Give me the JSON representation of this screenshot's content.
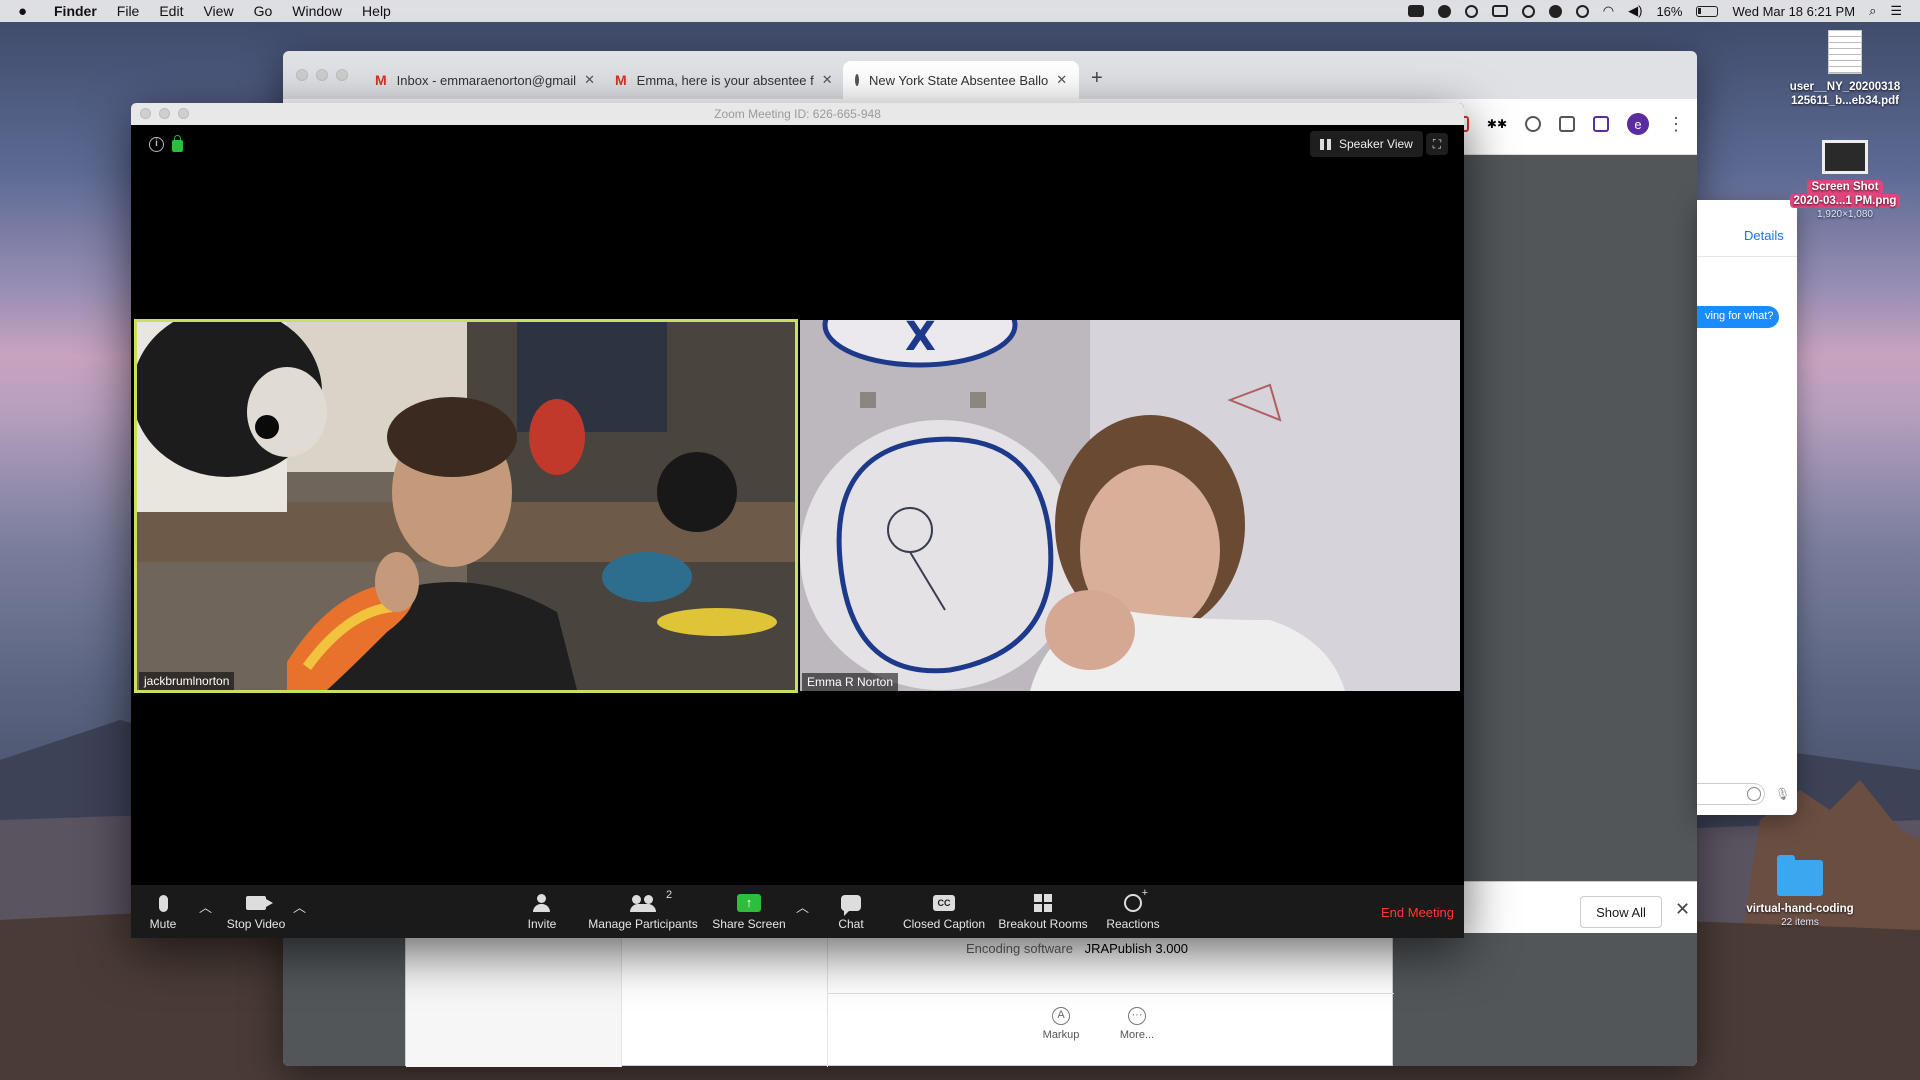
{
  "menubar": {
    "app": "Finder",
    "items": [
      "File",
      "Edit",
      "View",
      "Go",
      "Window",
      "Help"
    ],
    "battery": "16%",
    "datetime": "Wed Mar 18  6:21 PM"
  },
  "chrome": {
    "tabs": [
      {
        "label": "Inbox - emmaraenorton@gmail",
        "icon": "gmail-icon"
      },
      {
        "label": "Emma, here is your absentee f",
        "icon": "gmail-icon"
      },
      {
        "label": "New York State Absentee Ballo",
        "icon": "globe-icon"
      }
    ],
    "new_tab": "+",
    "profile_initial": "e",
    "downloads_show_all": "Show All",
    "downloads_close": "✕"
  },
  "preview": {
    "encoding_key": "Encoding software",
    "encoding_value": "JRAPublish 3.000",
    "markup_label": "Markup",
    "more_label": "More..."
  },
  "messages": {
    "details": "Details",
    "bubble": "ving for what?"
  },
  "zoom": {
    "title": "Zoom Meeting ID: 626-665-948",
    "speaker_view": "Speaker View",
    "participants": [
      {
        "name": "jackbrumlnorton"
      },
      {
        "name": "Emma R Norton"
      }
    ],
    "toolbar": {
      "mute": "Mute",
      "stop_video": "Stop Video",
      "invite": "Invite",
      "manage_participants": "Manage Participants",
      "participant_count": "2",
      "share_screen": "Share Screen",
      "chat": "Chat",
      "closed_caption": "Closed Caption",
      "cc_glyph": "CC",
      "breakout_rooms": "Breakout Rooms",
      "reactions": "Reactions",
      "end_meeting": "End Meeting"
    }
  },
  "desktop": {
    "pdf_file": {
      "line1": "user__NY_20200318",
      "line2": "125611_b...eb34.pdf"
    },
    "screenshot_file": {
      "line1": "Screen Shot",
      "line2": "2020-03...1 PM.png",
      "dims": "1,920×1,080"
    },
    "folder": {
      "name": "virtual-hand-coding",
      "items": "22 items"
    }
  },
  "colors": {
    "zoom_active_speaker": "#c8e05b",
    "zoom_end_meeting": "#ff3b30",
    "share_screen_green": "#2dbe3b",
    "imessage_blue": "#1a8cff"
  }
}
